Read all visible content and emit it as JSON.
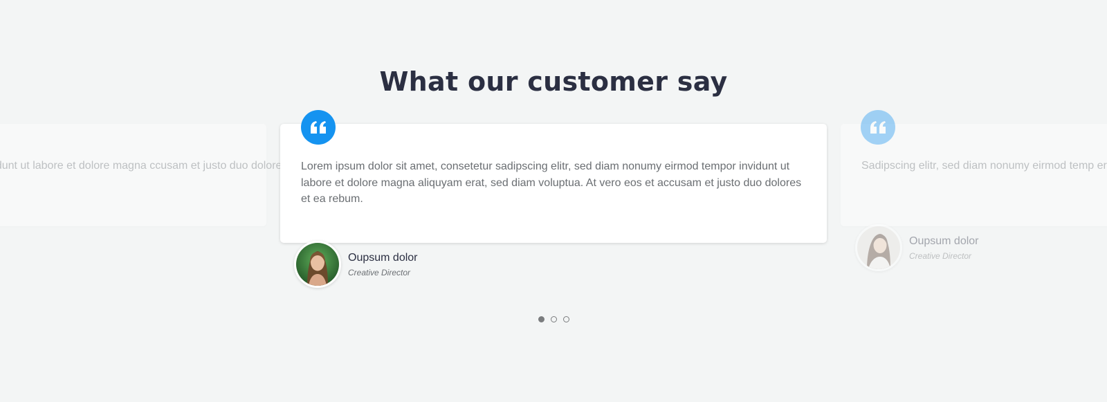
{
  "heading": "What our customer say",
  "colors": {
    "accent": "#1593f0",
    "background": "#f3f5f5",
    "heading": "#2b2f42"
  },
  "testimonials": [
    {
      "position": "previous",
      "text": "mod tempor invidunt ut labore et dolore magna ccusam et justo duo dolores et ea rebum."
    },
    {
      "position": "active",
      "icon": "quote-icon",
      "text": "Lorem ipsum dolor sit amet, consetetur sadipscing elitr, sed diam nonumy eirmod tempor invidunt ut labore et dolore magna aliquyam erat, sed diam voluptua. At vero eos et accusam et justo duo dolores et ea rebum.",
      "author_name": "Oupsum dolor",
      "author_role": "Creative Director"
    },
    {
      "position": "next",
      "icon": "quote-icon",
      "text": "Sadipscing elitr, sed diam nonumy eirmod temp erat, sed diam voluptua. At vero eos et accusam",
      "author_name": "Oupsum dolor",
      "author_role": "Creative Director"
    }
  ],
  "pagination": {
    "count": 3,
    "active_index": 0
  }
}
